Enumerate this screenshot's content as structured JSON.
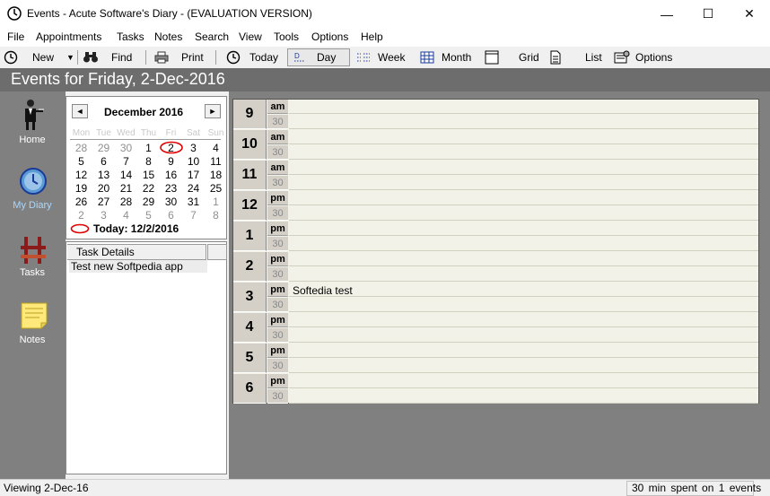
{
  "window": {
    "title": "Events - Acute Software's Diary - (EVALUATION VERSION)",
    "app_icon": "clock-icon",
    "minimize": "—",
    "maximize": "☐",
    "close": "✕"
  },
  "menu": [
    "File",
    "Appointments",
    "Tasks",
    "Notes",
    "Search",
    "View",
    "Tools",
    "Options",
    "Help"
  ],
  "toolbar": {
    "new": "New",
    "find": "Find",
    "print": "Print",
    "today": "Today",
    "day": "Day",
    "week": "Week",
    "month": "Month",
    "grid": "Grid",
    "list": "List",
    "options": "Options"
  },
  "header": {
    "title": "Events for Friday, 2-Dec-2016"
  },
  "nav": [
    {
      "label": "Home",
      "icon": "butler-icon"
    },
    {
      "label": "My Diary",
      "icon": "clock-icon"
    },
    {
      "label": "Tasks",
      "icon": "tasks-icon"
    },
    {
      "label": "Notes",
      "icon": "notepad-icon"
    }
  ],
  "calendar": {
    "month_label": "December 2016",
    "prev": "◄",
    "next": "►",
    "weekdays": [
      "Mon",
      "Tue",
      "Wed",
      "Thu",
      "Fri",
      "Sat",
      "Sun"
    ],
    "weeks": [
      [
        "28",
        "29",
        "30",
        "1",
        "2",
        "3",
        "4"
      ],
      [
        "5",
        "6",
        "7",
        "8",
        "9",
        "10",
        "11"
      ],
      [
        "12",
        "13",
        "14",
        "15",
        "16",
        "17",
        "18"
      ],
      [
        "19",
        "20",
        "21",
        "22",
        "23",
        "24",
        "25"
      ],
      [
        "26",
        "27",
        "28",
        "29",
        "30",
        "31",
        "1"
      ],
      [
        "2",
        "3",
        "4",
        "5",
        "6",
        "7",
        "8"
      ]
    ],
    "today_label": "Today:",
    "today_value": "12/2/2016"
  },
  "tasks": {
    "header": "Task Details",
    "items": [
      "Test new Softpedia app"
    ]
  },
  "schedule": {
    "hours": [
      {
        "hour": "9",
        "ampm": "am",
        "half": "30"
      },
      {
        "hour": "10",
        "ampm": "am",
        "half": "30"
      },
      {
        "hour": "11",
        "ampm": "am",
        "half": "30"
      },
      {
        "hour": "12",
        "ampm": "pm",
        "half": "30"
      },
      {
        "hour": "1",
        "ampm": "pm",
        "half": "30"
      },
      {
        "hour": "2",
        "ampm": "pm",
        "half": "30"
      },
      {
        "hour": "3",
        "ampm": "pm",
        "half": "30"
      },
      {
        "hour": "4",
        "ampm": "pm",
        "half": "30"
      },
      {
        "hour": "5",
        "ampm": "pm",
        "half": "30"
      },
      {
        "hour": "6",
        "ampm": "pm",
        "half": "30"
      }
    ],
    "events": [
      {
        "hour": "3",
        "text": "Softedia test"
      }
    ]
  },
  "status": {
    "left": "Viewing 2-Dec-16",
    "right": "30 min  spent on  1 events"
  },
  "colors": {
    "header_bg": "#6d6d6d",
    "nav_bg": "#808080",
    "hour_bg": "#d4d0c8",
    "today_circle": "#e00000"
  }
}
